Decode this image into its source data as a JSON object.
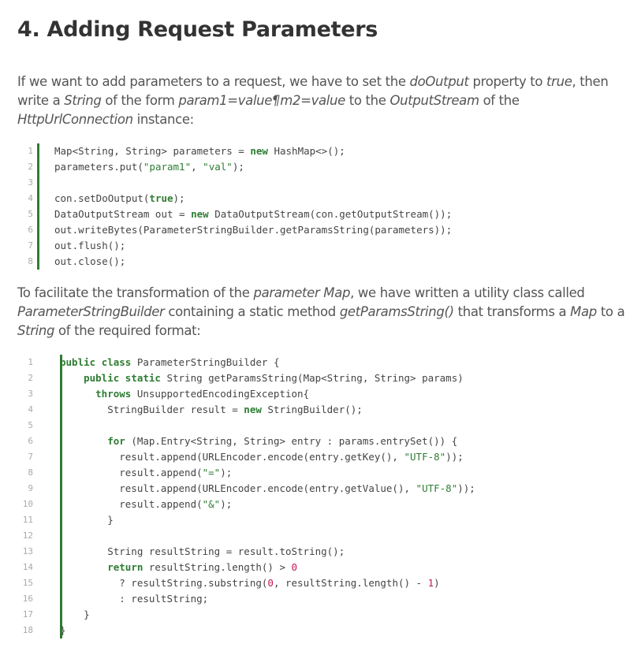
{
  "heading": "4. Adding Request Parameters",
  "para1": {
    "t1": "If we want to add parameters to a request, we have to set the ",
    "e1": "doOutput",
    "t2": " property to ",
    "e2": "true",
    "t3": ", then write a ",
    "e3": "String",
    "t4": " of the form ",
    "e4": "param1=value¶m2=value",
    "t5": " to the ",
    "e5": "OutputStream",
    "t6": " of the ",
    "e6": "HttpUrlConnection",
    "t7": " instance:"
  },
  "code1": [
    {
      "n": "1",
      "text": "Map<String, String> parameters = new HashMap<>();"
    },
    {
      "n": "2",
      "text": "parameters.put(\"param1\", \"val\");"
    },
    {
      "n": "3",
      "text": ""
    },
    {
      "n": "4",
      "text": "con.setDoOutput(true);"
    },
    {
      "n": "5",
      "text": "DataOutputStream out = new DataOutputStream(con.getOutputStream());"
    },
    {
      "n": "6",
      "text": "out.writeBytes(ParameterStringBuilder.getParamsString(parameters));"
    },
    {
      "n": "7",
      "text": "out.flush();"
    },
    {
      "n": "8",
      "text": "out.close();"
    }
  ],
  "para2": {
    "t1": "To facilitate the transformation of the ",
    "e1": "parameter Map",
    "t2": ", we have written a utility class called ",
    "e2": "ParameterStringBuilder",
    "t3": " containing a static method ",
    "e3": "getParamsString()",
    "t4": " that transforms a ",
    "e4": "Map",
    "t5": " to a ",
    "e5": "String",
    "t6": " of the required format:"
  },
  "code2": [
    {
      "n": "1",
      "text": "public class ParameterStringBuilder {"
    },
    {
      "n": "2",
      "text": "    public static String getParamsString(Map<String, String> params)"
    },
    {
      "n": "3",
      "text": "      throws UnsupportedEncodingException{"
    },
    {
      "n": "4",
      "text": "        StringBuilder result = new StringBuilder();"
    },
    {
      "n": "5",
      "text": ""
    },
    {
      "n": "6",
      "text": "        for (Map.Entry<String, String> entry : params.entrySet()) {"
    },
    {
      "n": "7",
      "text": "          result.append(URLEncoder.encode(entry.getKey(), \"UTF-8\"));"
    },
    {
      "n": "8",
      "text": "          result.append(\"=\");"
    },
    {
      "n": "9",
      "text": "          result.append(URLEncoder.encode(entry.getValue(), \"UTF-8\"));"
    },
    {
      "n": "10",
      "text": "          result.append(\"&\");"
    },
    {
      "n": "11",
      "text": "        }"
    },
    {
      "n": "12",
      "text": ""
    },
    {
      "n": "13",
      "text": "        String resultString = result.toString();"
    },
    {
      "n": "14",
      "text": "        return resultString.length() > 0"
    },
    {
      "n": "15",
      "text": "          ? resultString.substring(0, resultString.length() - 1)"
    },
    {
      "n": "16",
      "text": "          : resultString;"
    },
    {
      "n": "17",
      "text": "    }"
    },
    {
      "n": "18",
      "text": "}"
    }
  ]
}
